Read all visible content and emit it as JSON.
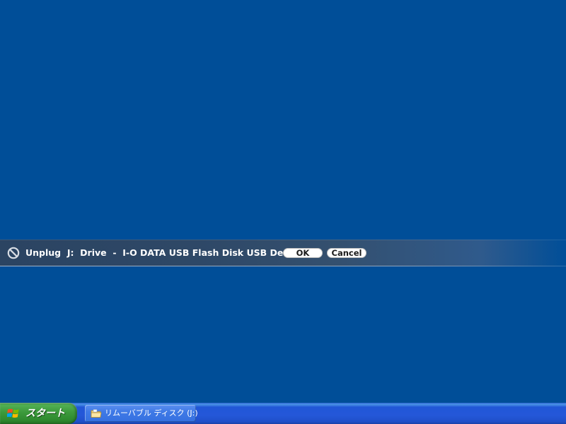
{
  "unplug_bar": {
    "message": "Unplug  J:  Drive  -  I-O DATA USB Flash Disk USB Device",
    "ok_label": "OK",
    "cancel_label": "Cancel",
    "icon": "no-entry-icon"
  },
  "taskbar": {
    "start_label": "スタート",
    "start_icon": "windows-logo-icon",
    "tasks": [
      {
        "label": "リムーバブル ディスク (J:)",
        "icon": "folder-icon"
      }
    ]
  },
  "colors": {
    "desktop": "#004e98",
    "taskbar": "#245edb",
    "start_button": "#3c9a3c",
    "unplug_bar": "#2e4867"
  }
}
